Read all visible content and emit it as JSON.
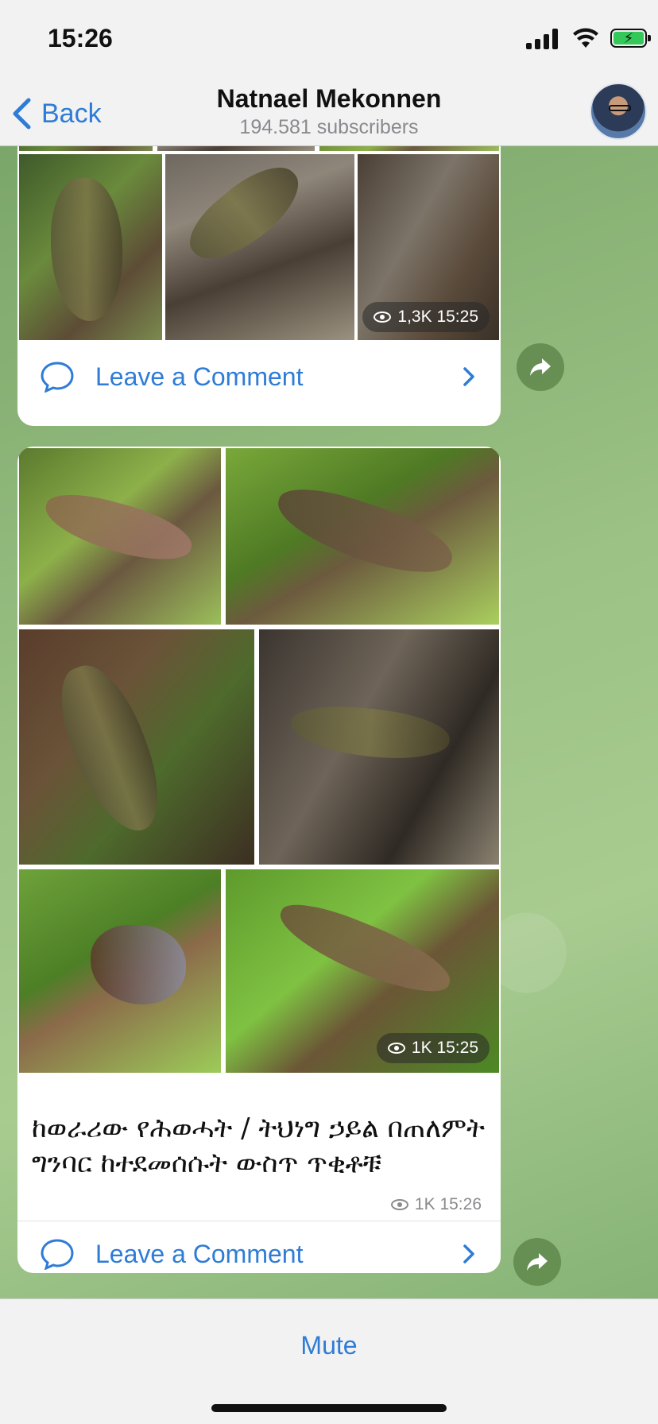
{
  "status_bar": {
    "time": "15:26"
  },
  "nav": {
    "back_label": "Back",
    "title": "Natnael Mekonnen",
    "subtitle": "194.581 subscribers"
  },
  "post1": {
    "views_time": "1,3K 15:25",
    "comment_label": "Leave a Comment"
  },
  "post2": {
    "views_time_overlay": "1K 15:25",
    "caption": "ከወራሪው የሕወሓት / ትህነግ ኃይል በጠለምት ግንባር ከተደመሰሱት ውስጥ ጥቂቶቹ",
    "meta": "1K 15:26",
    "comment_label": "Leave a Comment"
  },
  "bottom": {
    "mute_label": "Mute"
  },
  "colors": {
    "accent": "#2e7cd6",
    "battery": "#34c759"
  }
}
